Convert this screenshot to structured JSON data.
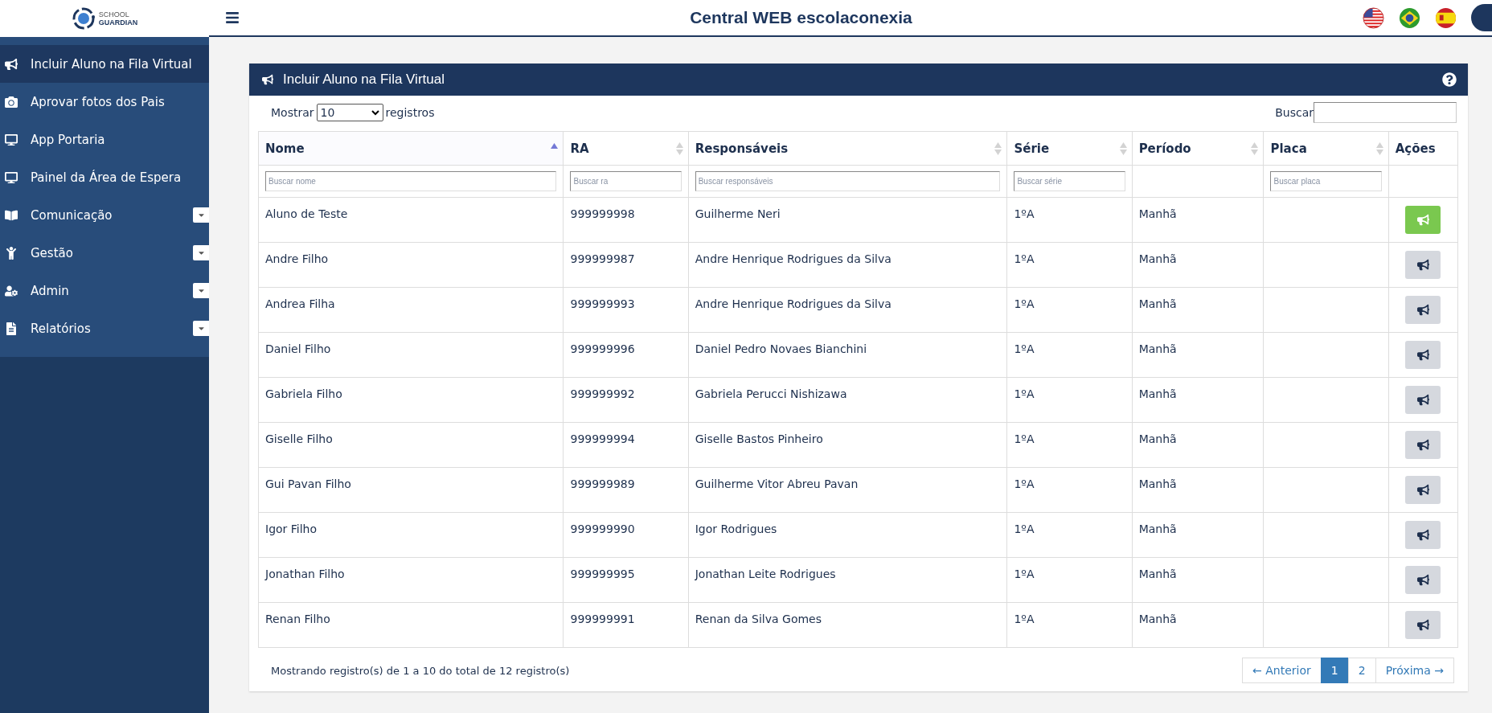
{
  "header": {
    "title": "Central WEB escolaconexia",
    "logo": {
      "line1": "SCHOOL",
      "line2": "GUARDIAN"
    }
  },
  "sidebar": {
    "items": [
      {
        "label": "Incluir Aluno na Fila Virtual",
        "selected": true,
        "expandable": false
      },
      {
        "label": "Aprovar fotos dos Pais",
        "selected": false,
        "expandable": false
      },
      {
        "label": "App Portaria",
        "selected": false,
        "expandable": false
      },
      {
        "label": "Painel da Área de Espera",
        "selected": false,
        "expandable": false
      },
      {
        "label": "Comunicação",
        "selected": false,
        "expandable": true
      },
      {
        "label": "Gestão",
        "selected": false,
        "expandable": true
      },
      {
        "label": "Admin",
        "selected": false,
        "expandable": true
      },
      {
        "label": "Relatórios",
        "selected": false,
        "expandable": true
      }
    ]
  },
  "panel": {
    "title": "Incluir Aluno na Fila Virtual",
    "length": {
      "before": "Mostrar",
      "value": "10",
      "after": "registros"
    },
    "search": {
      "label": "Buscar"
    },
    "table": {
      "columns": [
        {
          "label": "Nome",
          "sortable": true,
          "sorted": true,
          "placeholder": "Buscar nome"
        },
        {
          "label": "RA",
          "sortable": true,
          "sorted": false,
          "placeholder": "Buscar ra"
        },
        {
          "label": "Responsáveis",
          "sortable": true,
          "sorted": false,
          "placeholder": "Buscar responsáveis"
        },
        {
          "label": "Série",
          "sortable": true,
          "sorted": false,
          "placeholder": "Buscar série"
        },
        {
          "label": "Período",
          "sortable": true,
          "sorted": false
        },
        {
          "label": "Placa",
          "sortable": true,
          "sorted": false,
          "placeholder": "Buscar placa"
        },
        {
          "label": "Ações",
          "sortable": false,
          "sorted": false
        }
      ],
      "rows": [
        {
          "nome": "Aluno de Teste",
          "ra": "999999998",
          "responsaveis": "Guilherme Neri",
          "serie": "1ºA",
          "periodo": "Manhã",
          "active": true
        },
        {
          "nome": "Andre Filho",
          "ra": "999999987",
          "responsaveis": "Andre Henrique Rodrigues da Silva",
          "serie": "1ºA",
          "periodo": "Manhã",
          "active": false
        },
        {
          "nome": "Andrea Filha",
          "ra": "999999993",
          "responsaveis": "Andre Henrique Rodrigues da Silva",
          "serie": "1ºA",
          "periodo": "Manhã",
          "active": false
        },
        {
          "nome": "Daniel Filho",
          "ra": "999999996",
          "responsaveis": "Daniel Pedro Novaes Bianchini",
          "serie": "1ºA",
          "periodo": "Manhã",
          "active": false
        },
        {
          "nome": "Gabriela Filho",
          "ra": "999999992",
          "responsaveis": "Gabriela Perucci Nishizawa",
          "serie": "1ºA",
          "periodo": "Manhã",
          "active": false
        },
        {
          "nome": "Giselle Filho",
          "ra": "999999994",
          "responsaveis": "Giselle Bastos Pinheiro",
          "serie": "1ºA",
          "periodo": "Manhã",
          "active": false
        },
        {
          "nome": "Gui Pavan Filho",
          "ra": "999999989",
          "responsaveis": "Guilherme Vitor Abreu Pavan",
          "serie": "1ºA",
          "periodo": "Manhã",
          "active": false
        },
        {
          "nome": "Igor Filho",
          "ra": "999999990",
          "responsaveis": "Igor Rodrigues",
          "serie": "1ºA",
          "periodo": "Manhã",
          "active": false
        },
        {
          "nome": "Jonathan Filho",
          "ra": "999999995",
          "responsaveis": "Jonathan Leite Rodrigues",
          "serie": "1ºA",
          "periodo": "Manhã",
          "active": false
        },
        {
          "nome": "Renan Filho",
          "ra": "999999991",
          "responsaveis": "Renan da Silva Gomes",
          "serie": "1ºA",
          "periodo": "Manhã",
          "active": false
        }
      ]
    },
    "info": "Mostrando registro(s) de 1 a 10 do total de 12 registro(s)",
    "pagination": [
      {
        "label": "← Anterior",
        "selected": false
      },
      {
        "label": "1",
        "selected": true
      },
      {
        "label": "2",
        "selected": false
      },
      {
        "label": "Próxima →",
        "selected": false
      }
    ]
  }
}
